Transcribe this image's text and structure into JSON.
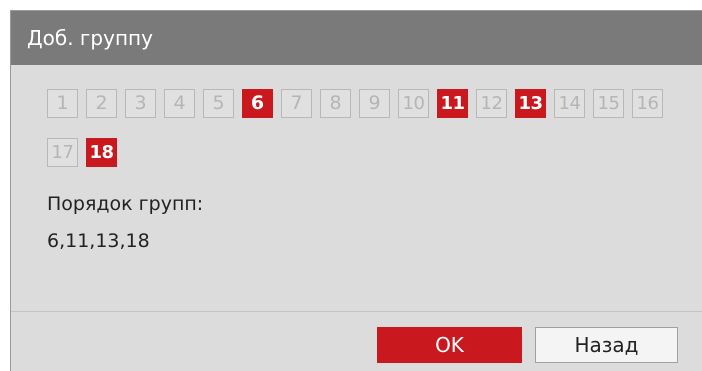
{
  "dialog": {
    "title": "Доб. группу"
  },
  "channels": {
    "row1": [
      {
        "label": "1",
        "selected": false
      },
      {
        "label": "2",
        "selected": false
      },
      {
        "label": "3",
        "selected": false
      },
      {
        "label": "4",
        "selected": false
      },
      {
        "label": "5",
        "selected": false
      },
      {
        "label": "6",
        "selected": true
      },
      {
        "label": "7",
        "selected": false
      },
      {
        "label": "8",
        "selected": false
      },
      {
        "label": "9",
        "selected": false
      },
      {
        "label": "10",
        "selected": false
      },
      {
        "label": "11",
        "selected": true
      },
      {
        "label": "12",
        "selected": false
      },
      {
        "label": "13",
        "selected": true
      },
      {
        "label": "14",
        "selected": false
      },
      {
        "label": "15",
        "selected": false
      },
      {
        "label": "16",
        "selected": false
      }
    ],
    "row2": [
      {
        "label": "17",
        "selected": false
      },
      {
        "label": "18",
        "selected": true
      }
    ]
  },
  "group_order": {
    "label": "Порядок групп:",
    "value": "6,11,13,18"
  },
  "buttons": {
    "ok_label": "OK",
    "back_label": "Назад"
  },
  "colors": {
    "accent": "#c9191e",
    "titlebar": "#7a7a7a",
    "panel": "#dcdcdc"
  }
}
